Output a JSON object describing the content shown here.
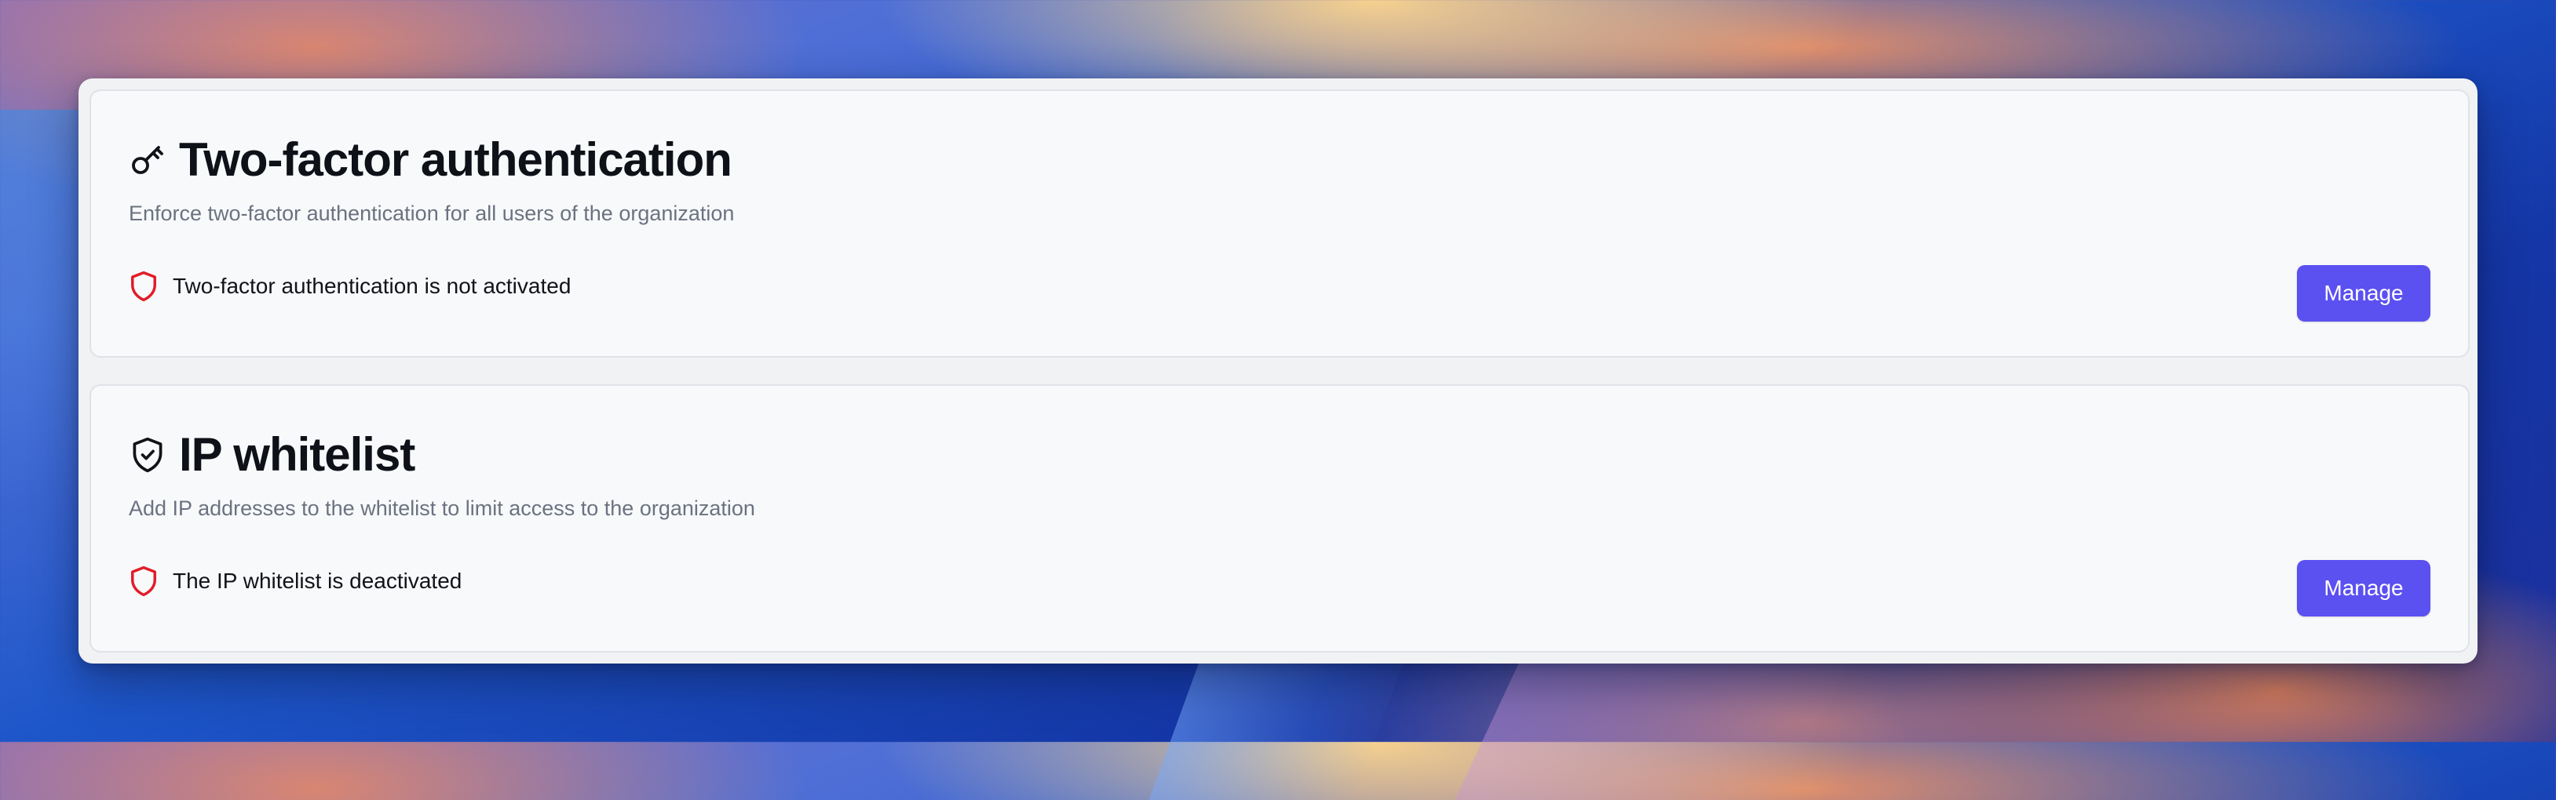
{
  "sections": [
    {
      "title": "Two-factor authentication",
      "description": "Enforce two-factor authentication for all users of the organization",
      "title_icon": "key-icon",
      "status_icon": "shield-icon",
      "status_text": "Two-factor authentication is not activated",
      "button_label": "Manage"
    },
    {
      "title": "IP whitelist",
      "description": "Add IP addresses to the whitelist to limit access to the organization",
      "title_icon": "shield-check-icon",
      "status_icon": "shield-icon",
      "status_text": "The IP whitelist is deactivated",
      "button_label": "Manage"
    }
  ],
  "colors": {
    "accent": "#5b50f0",
    "status_warning": "#e11d28",
    "title_text": "#0e1118",
    "muted_text": "#6b7280",
    "card_background": "#f8f9fb"
  }
}
